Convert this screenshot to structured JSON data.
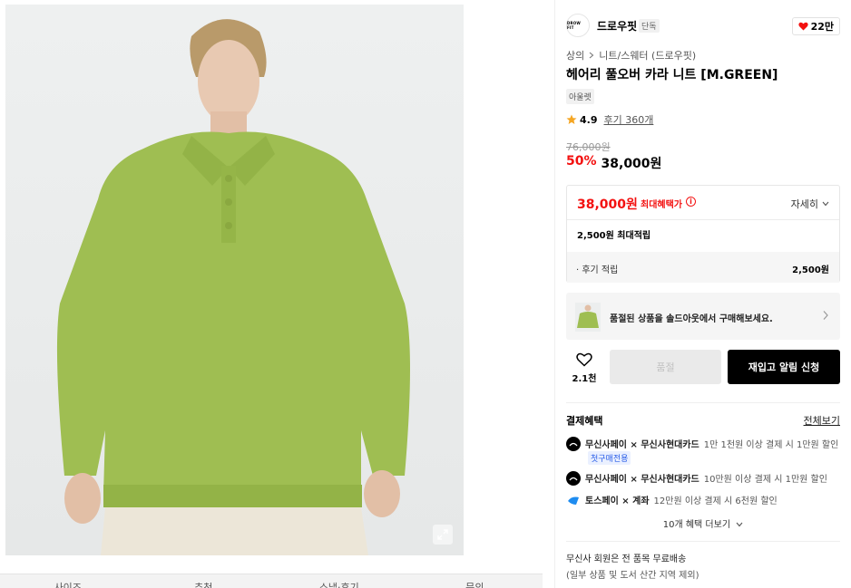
{
  "image": {
    "alt_name": "product-photo"
  },
  "tabs": [
    "사이즈",
    "추천",
    "스냅·후기",
    "문의"
  ],
  "brand": {
    "logo_text": "DROW FIT",
    "name": "드로우핏",
    "badge": "단독",
    "likes": "22만"
  },
  "breadcrumb": {
    "category": "상의",
    "sub": "니트/스웨터 (드로우핏)"
  },
  "product": {
    "title": "헤어리 풀오버 카라 니트 [M.GREEN]",
    "tag": "아울렛"
  },
  "rating": {
    "score": "4.9",
    "reviews": "후기 360개"
  },
  "price": {
    "original": "76,000원",
    "discount": "50%",
    "sale": "38,000원"
  },
  "benefit": {
    "max_price": "38,000원",
    "max_label": "최대혜택가",
    "detail": "자세히",
    "points": "2,500원 최대적립",
    "review_points_label": "· 후기 적립",
    "review_points_value": "2,500원"
  },
  "soldout_banner": {
    "text": "품절된 상품을 솔드아웃에서 구매해보세요."
  },
  "actions": {
    "wish_count": "2.1천",
    "soldout": "품절",
    "restock": "재입고 알림 신청"
  },
  "payment": {
    "title": "결제혜택",
    "view_all": "전체보기",
    "items": [
      {
        "name": "무신사페이 × 무신사현대카드",
        "desc": "1만 1천원 이상 결제 시 1만원 할인",
        "badge": "첫구매전용"
      },
      {
        "name": "무신사페이 × 무신사현대카드",
        "desc": "10만원 이상 결제 시 1만원 할인"
      },
      {
        "name": "토스페이 × 계좌",
        "desc": "12만원 이상 결제 시 6천원 할인"
      }
    ],
    "more": "10개 혜택 더보기"
  },
  "shipping": {
    "line1": "무신사 회원은 전 품목 무료배송",
    "line2": "(일부 상품 및 도서 산간 지역 제외)"
  },
  "colors": {
    "accent_red": "#f31110",
    "sweater": "#9fbe52"
  }
}
